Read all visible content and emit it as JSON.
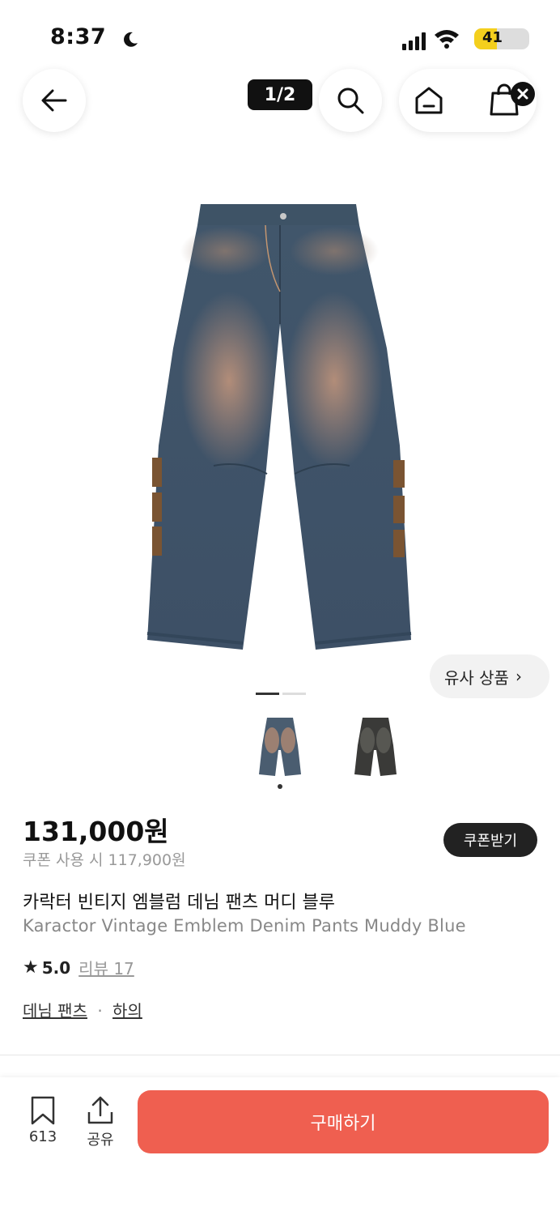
{
  "status_bar": {
    "time": "8:37",
    "battery_percent": "41",
    "battery_level": 0.41
  },
  "nav": {
    "page_indicator": "1/2"
  },
  "gallery": {
    "similar_products_label": "유사 상품",
    "current_image": 1,
    "total_images": 2,
    "thumbnails": [
      "blue-denim-thumbnail",
      "black-denim-thumbnail"
    ]
  },
  "product": {
    "price": "131,000원",
    "coupon_price": "쿠폰 사용 시 117,900원",
    "coupon_button": "쿠폰받기",
    "title_ko": "카락터 빈티지 엠블럼 데님 팬츠 머디 블루",
    "title_en": "Karactor Vintage Emblem Denim Pants Muddy Blue",
    "rating": "5.0",
    "review_label": "리뷰 17",
    "categories": [
      "데님 팬츠",
      "하의"
    ],
    "category_separator": "·"
  },
  "bottom_bar": {
    "bookmark_count": "613",
    "share_label": "공유",
    "buy_label": "구매하기"
  },
  "colors": {
    "buy_button": "#ef5f50",
    "coupon_button": "#222222",
    "battery": "#f4cf1d"
  }
}
